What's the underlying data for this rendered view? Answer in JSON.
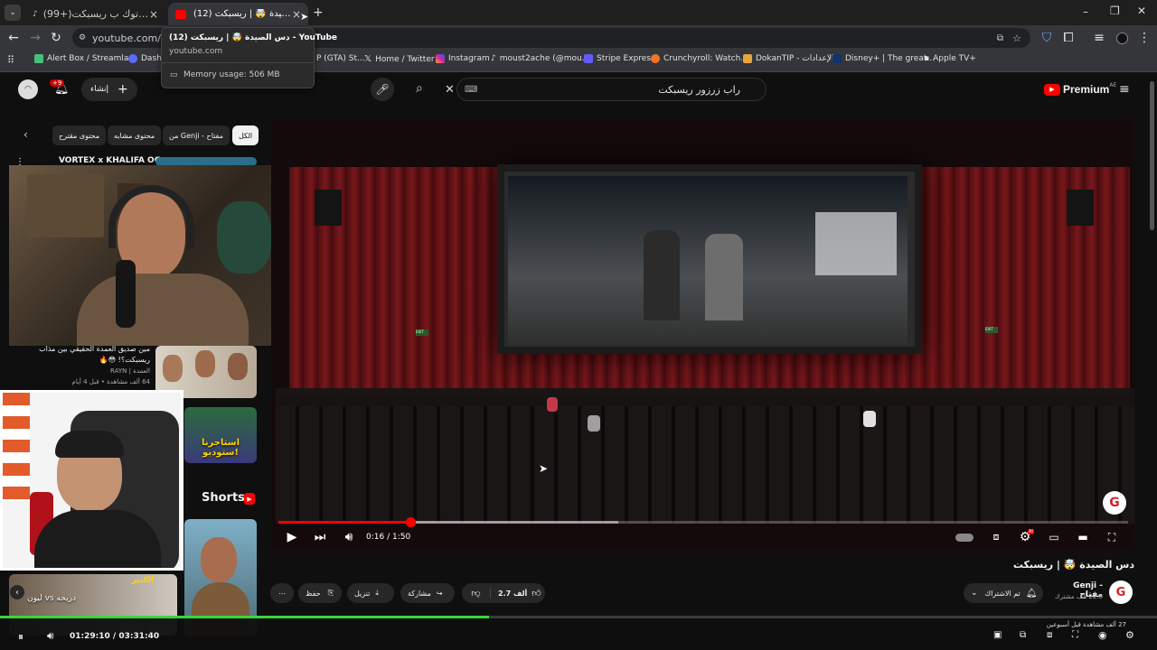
{
  "browser": {
    "tabs": [
      {
        "label": "(99+)اخيرا التيك توك ب ريسبكت",
        "active": false
      },
      {
        "label": "(12) دس الصيدة 🤯 | ريسبكت -",
        "active": true
      }
    ],
    "new_tab": "+",
    "url": "youtube.com/wat",
    "tooltip": {
      "title": "(12) دس الصيدة 🤯 | ريسبكت - YouTube",
      "domain": "youtube.com",
      "memory": "Memory usage: 506 MB"
    },
    "bookmarks": [
      "Alert Box / Streamla...",
      "Dashb",
      "P (GTA) St...",
      "Home / Twitter",
      "Instagram",
      "moust2ache (@mou...",
      "Stripe Express",
      "Crunchyroll: Watch...",
      "DokanTIP - الإعدادات",
      "Disney+ | The great...",
      "Apple TV+"
    ]
  },
  "youtube": {
    "logo": "Premium",
    "logo_sup": "AE",
    "search_query": "راب زرزور ريسبكت",
    "create_label": "إنشاء",
    "notif_count": "+9",
    "chips": [
      "الكل",
      "من Genji - مفتاح",
      "محتوى مشابه",
      "محتوى مقترح"
    ],
    "related_top": "VORTEX x KHALIFA OG -",
    "related": [
      {
        "title": "مين صديق العمدة الحقيقي بين مذاب ريسبكت؟! 😳🔥",
        "channel": "RAYN | العمدة",
        "meta": "64 ألف مشاهدة • قبل 4 أيام"
      }
    ],
    "thumb_text": "استاجرنا ستوديو!",
    "shorts_label": "Shorts",
    "short_text": "الكبير",
    "short_caption": "ليون vs دريحه",
    "player": {
      "time": "0:16 / 1:50",
      "progress": 0.155,
      "buffer": 0.4,
      "autoplay": "AI"
    },
    "video_title": "دس الصيدة 🤯 | ريسبكت",
    "channel_name": "Genji - مفتاح",
    "subscribers": "22.6 ألف مشترك",
    "subscribe_label": "تم الاشتراك",
    "likes": "2.7 ألف",
    "share_label": "مشاركة",
    "download_label": "تنزيل",
    "save_label": "حفظ",
    "views": "27 ألف مشاهدة قبل أسبوعين"
  },
  "stream_overlay": {
    "time": "01:29:10 / 03:31:40",
    "progress": 0.423
  },
  "colors": {
    "brand_red": "#ff0000",
    "stream_green": "#3ad63a"
  }
}
